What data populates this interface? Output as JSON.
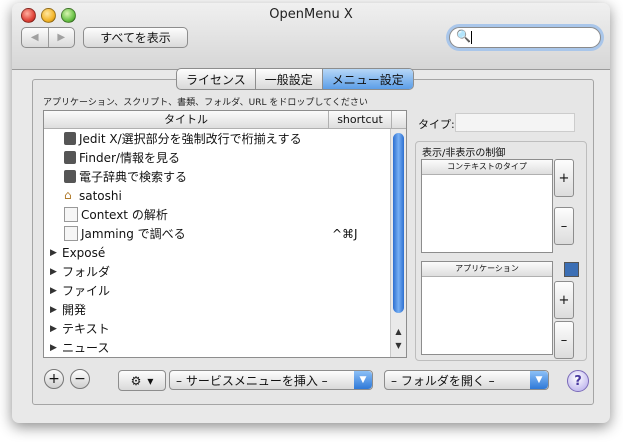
{
  "window": {
    "title": "OpenMenu X"
  },
  "toolbar": {
    "back_icon": "back-arrow-icon",
    "forward_icon": "forward-arrow-icon",
    "back_glyph": "◀",
    "forward_glyph": "▶",
    "show_all_label": "すべてを表示",
    "search_value": "",
    "search_icon": "search-icon",
    "search_glyph": "🔍"
  },
  "tabs": [
    {
      "label": "ライセンス",
      "active": false
    },
    {
      "label": "一般設定",
      "active": false
    },
    {
      "label": "メニュー設定",
      "active": true
    }
  ],
  "hint": "アプリケーション、スクリプト、書類、フォルダ、URL をドロップしてください",
  "table": {
    "columns": {
      "title": "タイトル",
      "shortcut": "shortcut"
    },
    "rows": [
      {
        "title": "Jedit X/選択部分を強制改行で桁揃えする",
        "shortcut": "",
        "icon": "script-icon"
      },
      {
        "title": "Finder/情報を見る",
        "shortcut": "",
        "icon": "script-icon"
      },
      {
        "title": "電子辞典で検索する",
        "shortcut": "",
        "icon": "script-icon"
      },
      {
        "title": "satoshi",
        "shortcut": "",
        "icon": "home-folder-icon"
      },
      {
        "title": "Context の解析",
        "shortcut": "",
        "icon": "document-icon"
      },
      {
        "title": "Jamming で調べる",
        "shortcut": "^⌘J",
        "icon": "document-icon"
      },
      {
        "title": "Exposé",
        "shortcut": "",
        "icon": "disclosure-triangle-icon"
      },
      {
        "title": "フォルダ",
        "shortcut": "",
        "icon": "disclosure-triangle-icon"
      },
      {
        "title": "ファイル",
        "shortcut": "",
        "icon": "disclosure-triangle-icon"
      },
      {
        "title": "開発",
        "shortcut": "",
        "icon": "disclosure-triangle-icon"
      },
      {
        "title": "テキスト",
        "shortcut": "",
        "icon": "disclosure-triangle-icon"
      },
      {
        "title": "ニュース",
        "shortcut": "",
        "icon": "disclosure-triangle-icon"
      }
    ],
    "scroll_up_glyph": "▲",
    "scroll_down_glyph": "▼"
  },
  "right_panel": {
    "type_label": "タイプ:",
    "type_value": "",
    "visibility_title": "表示/非表示の制御",
    "context_types_header": "コンテキストのタイプ",
    "applications_header": "アプリケーション",
    "add_label": "+",
    "remove_label": "–"
  },
  "bottom": {
    "add_label": "+",
    "remove_label": "−",
    "gear_glyph": "⚙",
    "gear_arrow": "▾",
    "services_popup": "– サービスメニューを挿入 –",
    "folder_popup": "– フォルダを開く –",
    "popup_arrow": "▼",
    "help_label": "?"
  },
  "colors": {
    "accent": "#3a82e0",
    "active_tab": "#5c9ee8"
  }
}
